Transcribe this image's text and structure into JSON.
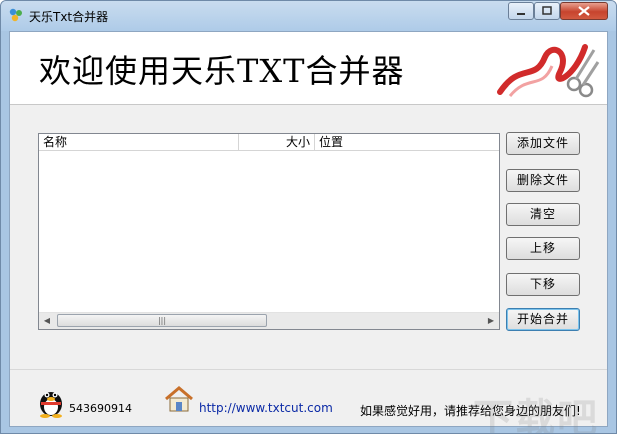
{
  "window": {
    "title": "天乐Txt合并器"
  },
  "banner": {
    "text": "欢迎使用天乐TXT合并器"
  },
  "file_list": {
    "columns": [
      "名称",
      "大小",
      "位置"
    ],
    "rows": []
  },
  "buttons": {
    "add": "添加文件",
    "delete": "删除文件",
    "clear": "清空",
    "move_up": "上移",
    "move_down": "下移",
    "start": "开始合并"
  },
  "footer": {
    "qq": "543690914",
    "url": "http://www.txtcut.com",
    "recommend": "如果感觉好用，请推荐给您身边的朋友们!"
  },
  "watermark": "下载吧",
  "icons": {
    "app": "app-icon",
    "qq": "qq-penguin-icon",
    "home": "home-icon",
    "ribbon": "ribbon-scissors-icon"
  }
}
